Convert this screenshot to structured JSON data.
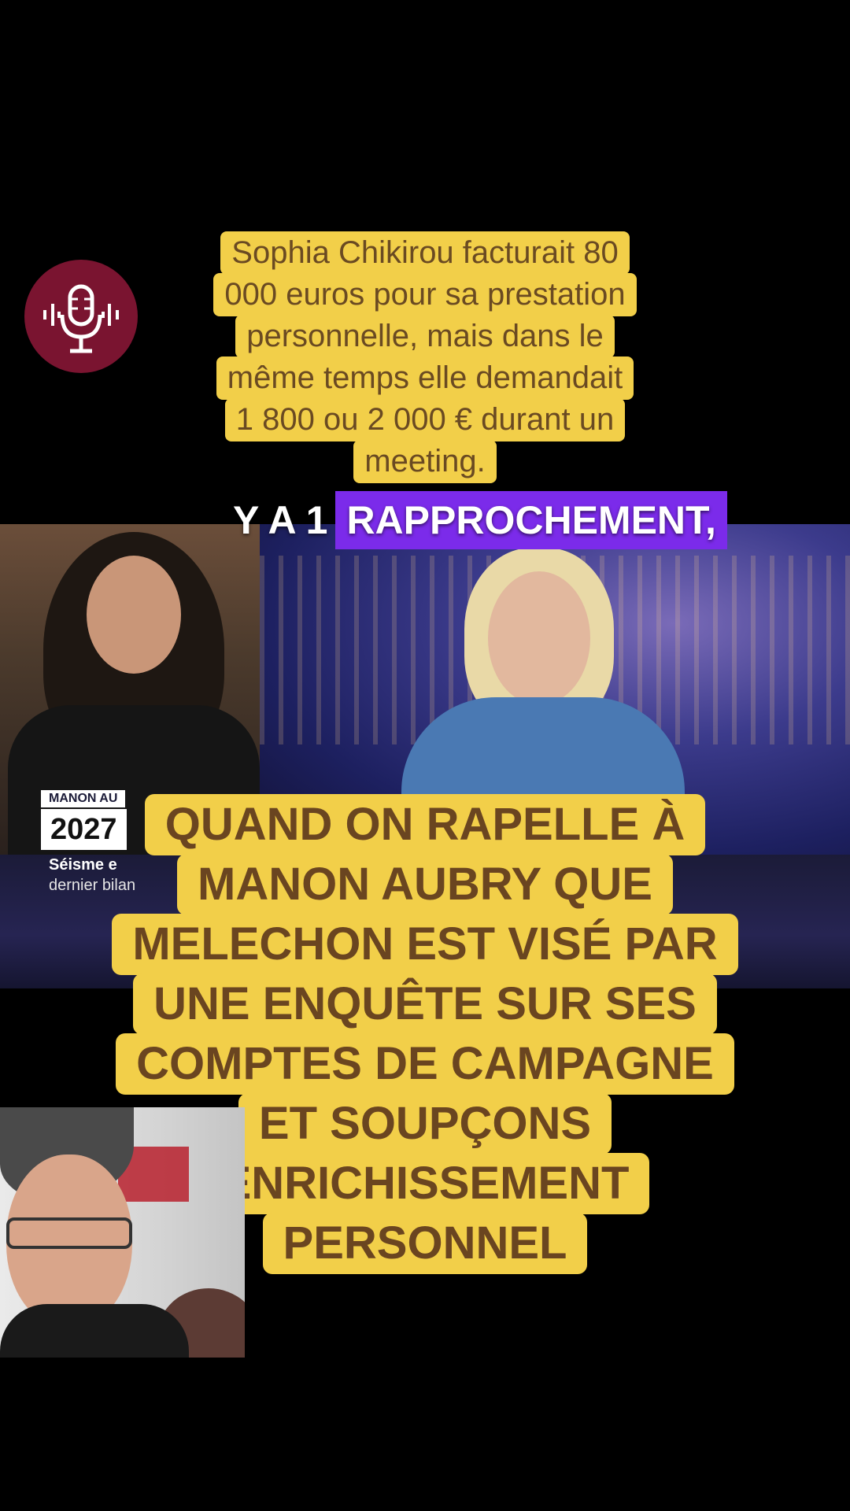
{
  "badge": {
    "icon": "podcast-mic-icon",
    "color": "#7a1430"
  },
  "top_caption": {
    "lines": [
      "Sophia Chikirou facturait 80",
      "000 euros pour sa prestation",
      "personnelle, mais dans le",
      "même temps elle demandait",
      "1 800 ou 2 000 € durant un",
      "meeting."
    ]
  },
  "subtitle": {
    "plain": "Y A 1",
    "highlight": "RAPPROCHEMENT,"
  },
  "ticker": {
    "tag": "MANON AU",
    "year": "2027",
    "headline": "Séisme e",
    "sub": "dernier bilan"
  },
  "big_caption": {
    "lines": [
      "QUAND ON RAPELLE À",
      "MANON AUBRY QUE",
      "MELECHON EST VISÉ PAR",
      "UNE ENQUÊTE SUR SES",
      "COMPTES DE CAMPAGNE",
      "ET SOUPÇONS",
      "ENRICHISSEMENT",
      "PERSONNEL"
    ]
  },
  "colors": {
    "caption_bg": "#f2cf49",
    "caption_text": "#6a4520",
    "highlight": "#7b2bea"
  }
}
